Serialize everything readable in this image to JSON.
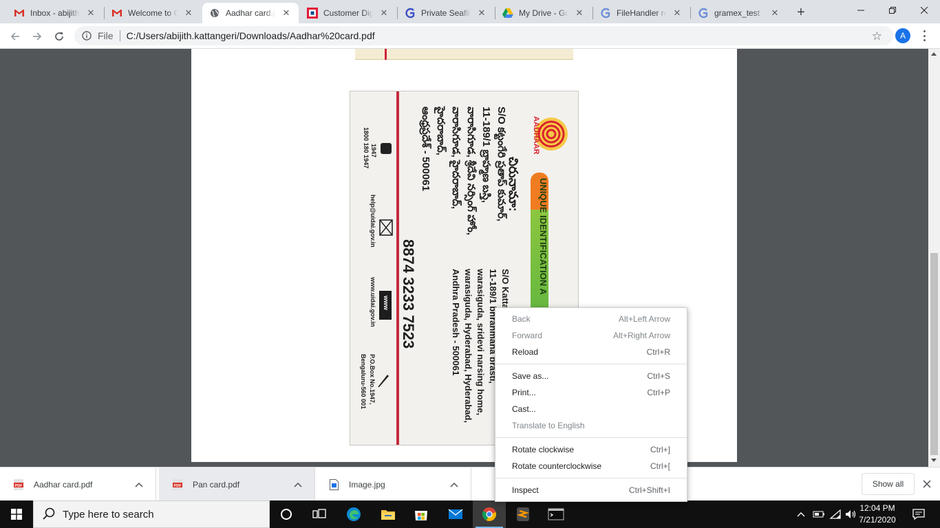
{
  "browser": {
    "tabs": [
      {
        "title": "Inbox - abijith.kattangeri@gmail.com",
        "icon": "gmail-icon"
      },
      {
        "title": "Welcome to Gmail",
        "icon": "gmail-icon"
      },
      {
        "title": "Aadhar card.pdf",
        "icon": "globe-icon",
        "active": true
      },
      {
        "title": "Customer Digital Banking",
        "icon": "hdfc-icon"
      },
      {
        "title": "Private Seafile",
        "icon": "g-icon"
      },
      {
        "title": "My Drive - Google Drive",
        "icon": "drive-icon"
      },
      {
        "title": "FileHandler reference",
        "icon": "g-icon"
      },
      {
        "title": "gramex_test",
        "icon": "g-icon"
      }
    ],
    "url_scheme": "File",
    "url": "C:/Users/abijith.kattangeri/Downloads/Aadhar%20card.pdf",
    "profile_initial": "A"
  },
  "card": {
    "logo_text": "AADHAAR",
    "band_text": "UNIQUE IDENTIFICATION A",
    "telugu_title": "చిరునామా:",
    "telugu_lines": [
      "S/O కట్టంగేరి ప్రతాప్ కుమార్,",
      "11-189/1 బ్రాహ్మణ బస్తి,",
      "వారాసిగూడ, శ్రీదేవి నర్సింగ్ హోం,",
      "వారాసిగూడ, హైదరాబాద్,",
      "హైదరాబాద్,",
      "ఆంధ్రప్రదేశ్ - 500061"
    ],
    "address_lines": [
      "S/O Katta",
      "11-189/1 bhrahmana brasti,",
      "warasiguda, sridevi narsing home,",
      "warasiguda, Hyderabad, Hyderabad,",
      "Andhra Pradesh - 500061"
    ],
    "number": "8874 3233 7523",
    "phone": "1947",
    "phone_alt": "1800 180 1947",
    "email": "help@uidai.gov.in",
    "web_badge": "www",
    "website": "www.uidai.gov.in",
    "po_box": "P.O.Box No.1947,",
    "po_city": "Bengaluru-560 001"
  },
  "context_menu": {
    "groups": [
      [
        {
          "label": "Back",
          "shortcut": "Alt+Left Arrow",
          "disabled": true
        },
        {
          "label": "Forward",
          "shortcut": "Alt+Right Arrow",
          "disabled": true
        },
        {
          "label": "Reload",
          "shortcut": "Ctrl+R",
          "disabled": false
        }
      ],
      [
        {
          "label": "Save as...",
          "shortcut": "Ctrl+S",
          "disabled": false
        },
        {
          "label": "Print...",
          "shortcut": "Ctrl+P",
          "disabled": false
        },
        {
          "label": "Cast...",
          "shortcut": "",
          "disabled": false
        },
        {
          "label": "Translate to English",
          "shortcut": "",
          "disabled": true
        }
      ],
      [
        {
          "label": "Rotate clockwise",
          "shortcut": "Ctrl+]",
          "disabled": false
        },
        {
          "label": "Rotate counterclockwise",
          "shortcut": "Ctrl+[",
          "disabled": false
        }
      ],
      [
        {
          "label": "Inspect",
          "shortcut": "Ctrl+Shift+I",
          "disabled": false
        }
      ]
    ]
  },
  "downloads": {
    "items": [
      {
        "name": "Aadhar card.pdf",
        "icon": "pdf-icon"
      },
      {
        "name": "Pan card.pdf",
        "icon": "pdf-icon"
      },
      {
        "name": "Image.jpg",
        "icon": "image-file-icon"
      }
    ],
    "show_all": "Show all"
  },
  "taskbar": {
    "search_placeholder": "Type here to search",
    "time": "12:04 PM",
    "date": "7/21/2020"
  }
}
